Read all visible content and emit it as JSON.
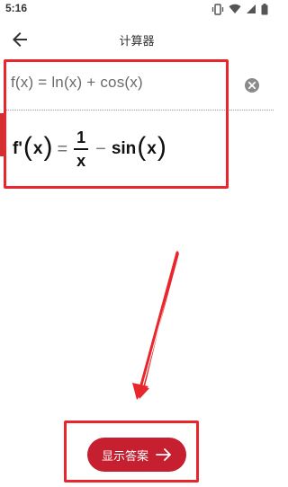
{
  "status_bar": {
    "time": "5:16",
    "icons": [
      "vibrate-icon",
      "wifi-icon",
      "cell-signal-icon",
      "battery-icon"
    ]
  },
  "app_bar": {
    "back_icon": "arrow-left-icon",
    "title": "计算器"
  },
  "input": {
    "expression": "f(x) = ln(x) + cos(x)",
    "clear_icon": "clear-circle-icon"
  },
  "result": {
    "func": "f'",
    "var": "x",
    "equals": "=",
    "numerator": "1",
    "denominator": "x",
    "minus": "−",
    "sin": "sin",
    "sin_arg": "x"
  },
  "action": {
    "show_answer_label": "显示答案",
    "arrow_icon": "arrow-right-icon"
  },
  "colors": {
    "accent": "#c62030",
    "annotation": "#e8262b",
    "text_primary": "#111111",
    "text_secondary": "#6b6b6b"
  }
}
